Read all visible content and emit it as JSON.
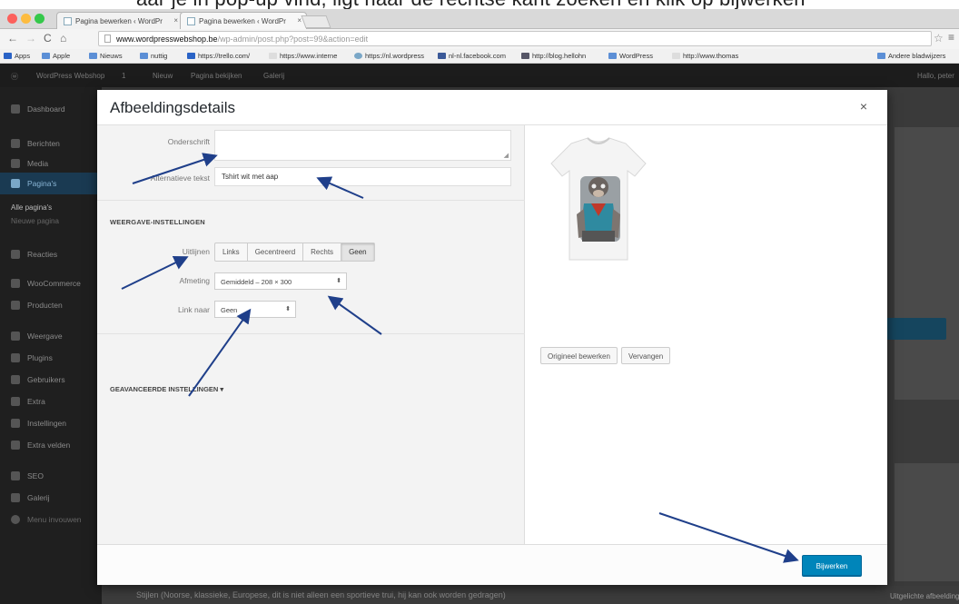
{
  "caption_top": "aar je in pop-up vind, ligt naar de rechtse kant zoeken en klik op bijwerken",
  "browser": {
    "tabs": [
      {
        "label": "Pagina bewerken ‹ WordPr"
      },
      {
        "label": "Pagina bewerken ‹ WordPr"
      }
    ],
    "url_domain": "www.wordpresswebshop.be",
    "url_path": "/wp-admin/post.php?post=99&action=edit",
    "bookmarks": [
      "Apps",
      "Apple",
      "Nieuws",
      "nuttig",
      "https://trello.com/",
      "https://www.interne",
      "https://nl.wordpress",
      "nl-nl.facebook.com",
      "http://blog.hellohn",
      "WordPress",
      "http://www.thomas",
      "Andere bladwijzers"
    ]
  },
  "wp": {
    "adminbar": [
      "WordPress Webshop",
      "1",
      "0",
      "Nieuw",
      "Pagina bekijken",
      "Galerij",
      "Hallo, peter"
    ],
    "sidebar": [
      {
        "label": "Dashboard"
      },
      {
        "label": "Berichten"
      },
      {
        "label": "Media"
      },
      {
        "label": "Pagina's"
      },
      {
        "label": "Reacties"
      },
      {
        "label": "WooCommerce"
      },
      {
        "label": "Producten"
      },
      {
        "label": "Weergave"
      },
      {
        "label": "Plugins"
      },
      {
        "label": "Gebruikers"
      },
      {
        "label": "Extra"
      },
      {
        "label": "Instellingen"
      },
      {
        "label": "Extra velden"
      },
      {
        "label": "SEO"
      },
      {
        "label": "Galerij"
      },
      {
        "label": "Menu invouwen"
      }
    ],
    "sidebar_sub": [
      "Alle pagina's",
      "Nieuwe pagina"
    ],
    "bottom_text": "Stijlen (Noorse, klassieke, Europese, dit is niet alleen een sportieve trui, hij kan ook worden gedragen)",
    "bottom_right": "Uitgelichte afbeelding"
  },
  "modal": {
    "title": "Afbeeldingsdetails",
    "close": "×",
    "fields": {
      "caption_label": "Onderschrift",
      "caption_value": "",
      "alt_label": "Alternatieve tekst",
      "alt_value": "Tshirt wit met aap"
    },
    "display_settings_title": "WEERGAVE-INSTELLINGEN",
    "align_label": "Uitlijnen",
    "align_options": [
      "Links",
      "Gecentreerd",
      "Rechts",
      "Geen"
    ],
    "align_selected": "Geen",
    "size_label": "Afmeting",
    "size_value": "Gemiddeld – 208 × 300",
    "link_label": "Link naar",
    "link_value": "Geen",
    "advanced_title": "GEAVANCEERDE INSTELLINGEN",
    "preview_buttons": [
      "Origineel bewerken",
      "Vervangen"
    ],
    "update_button": "Bijwerken"
  },
  "colors": {
    "primary_button": "#0085ba",
    "arrow": "#1f3f8a",
    "admin_dark": "#1f1f1f"
  },
  "icons": [
    "close-icon",
    "dropdown-arrow-icon",
    "back-icon",
    "forward-icon",
    "reload-icon",
    "home-icon",
    "star-icon",
    "menu-icon"
  ]
}
